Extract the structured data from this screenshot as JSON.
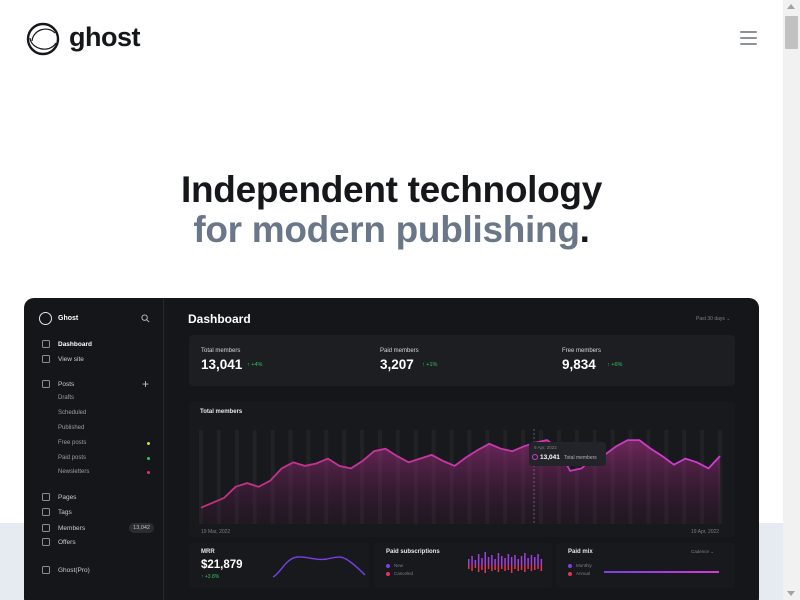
{
  "header": {
    "logo_text": "ghost",
    "menu_icon": "hamburger-menu-icon"
  },
  "hero": {
    "line1": "Independent technology",
    "line2": "for modern publishing",
    "punctuation": "."
  },
  "colors": {
    "heading": "#15171a",
    "heading_muted": "#6a7788",
    "dashboard_bg": "#151619",
    "accent_pink": "#d13bd6",
    "accent_green": "#2fc55a",
    "band": "#e6ebf1"
  },
  "dashboard": {
    "brand": "Ghost",
    "title": "Dashboard",
    "range": "Past 30 days ⌄",
    "nav": {
      "dashboard": "Dashboard",
      "view_site": "View site",
      "posts": "Posts",
      "drafts": "Drafts",
      "scheduled": "Scheduled",
      "published": "Published",
      "free_posts": "Free posts",
      "paid_posts": "Paid posts",
      "newsletters": "Newsletters",
      "pages": "Pages",
      "tags": "Tags",
      "members": "Members",
      "members_count": "13,042",
      "offers": "Offers",
      "ghost_pro": "Ghost(Pro)"
    },
    "stats": [
      {
        "label": "Total members",
        "value": "13,041",
        "change": "↑ +4%"
      },
      {
        "label": "Paid members",
        "value": "3,207",
        "change": "↑ +1%"
      },
      {
        "label": "Free members",
        "value": "9,834",
        "change": "↑ +6%"
      }
    ],
    "chart": {
      "title": "Total members",
      "x_start": "19 Mar, 2022",
      "x_end": "19 Apr, 2022",
      "tooltip_date": "9 Apr, 2022",
      "tooltip_value": "13,041",
      "tooltip_label": "Total members"
    },
    "mrr": {
      "label": "MRR",
      "value": "$21,879",
      "change": "↑ +3.8%"
    },
    "paid_subs": {
      "label": "Paid subscriptions",
      "legend_new": "New",
      "legend_canceled": "Canceled"
    },
    "paid_mix": {
      "label": "Paid mix",
      "cadence": "Cadence ⌄",
      "legend_monthly": "Monthly",
      "legend_annual": "Annual"
    }
  },
  "chart_data": {
    "type": "area",
    "title": "Total members",
    "series": [
      {
        "values": [
          10,
          14,
          18,
          27,
          30,
          27,
          32,
          42,
          47,
          44,
          46,
          50,
          44,
          42,
          48,
          56,
          58,
          52,
          47,
          50,
          53,
          48,
          44,
          51,
          57,
          62,
          58,
          56,
          60,
          63,
          65,
          58,
          40,
          42,
          51,
          53,
          60,
          65,
          65,
          58,
          52,
          45,
          50,
          47,
          42,
          52
        ]
      }
    ],
    "x_range": [
      "19 Mar, 2022",
      "19 Apr, 2022"
    ]
  }
}
